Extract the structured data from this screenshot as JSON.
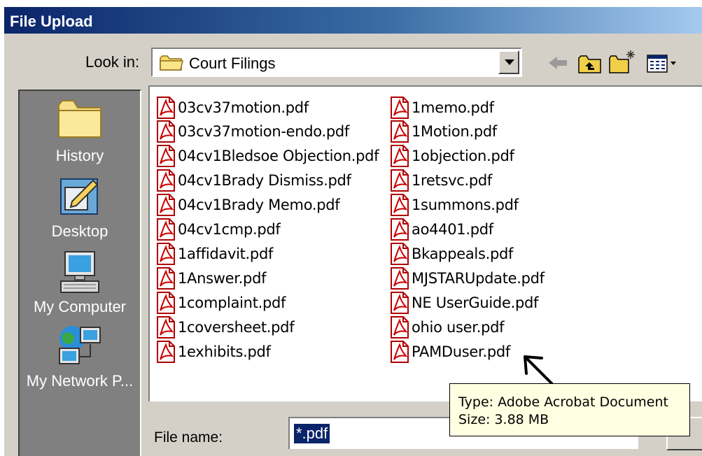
{
  "dialog": {
    "title": "File Upload",
    "look_in_label": "Look in:",
    "current_folder": "Court Filings"
  },
  "places": [
    {
      "label": "History",
      "icon": "history-folder-icon"
    },
    {
      "label": "Desktop",
      "icon": "desktop-icon"
    },
    {
      "label": "My Computer",
      "icon": "my-computer-icon"
    },
    {
      "label": "My Network P...",
      "icon": "my-network-places-icon"
    }
  ],
  "files": [
    "03cv37motion.pdf",
    "03cv37motion-endo.pdf",
    "04cv1Bledsoe Objection.pdf",
    "04cv1Brady Dismiss.pdf",
    "04cv1Brady Memo.pdf",
    "04cv1cmp.pdf",
    "1affidavit.pdf",
    "1Answer.pdf",
    "1complaint.pdf",
    "1coversheet.pdf",
    "1exhibits.pdf",
    "1memo.pdf",
    "1Motion.pdf",
    "1objection.pdf",
    "1retsvc.pdf",
    "1summons.pdf",
    "ao4401.pdf",
    "Bkappeals.pdf",
    "MJSTARUpdate.pdf",
    "NE UserGuide.pdf",
    "ohio user.pdf",
    "PAMDuser.pdf"
  ],
  "file_name": {
    "label": "File name:",
    "value": "*.pdf"
  },
  "tooltip": {
    "type_line": "Type: Adobe Acrobat Document",
    "size_line": "Size: 3.88 MB"
  },
  "colors": {
    "title_bar": "#0a246a",
    "dialog_face": "#d4d0c8",
    "places_bar": "#808080",
    "tooltip_bg": "#ffffe1",
    "pdf_icon_red": "#cc0000"
  }
}
